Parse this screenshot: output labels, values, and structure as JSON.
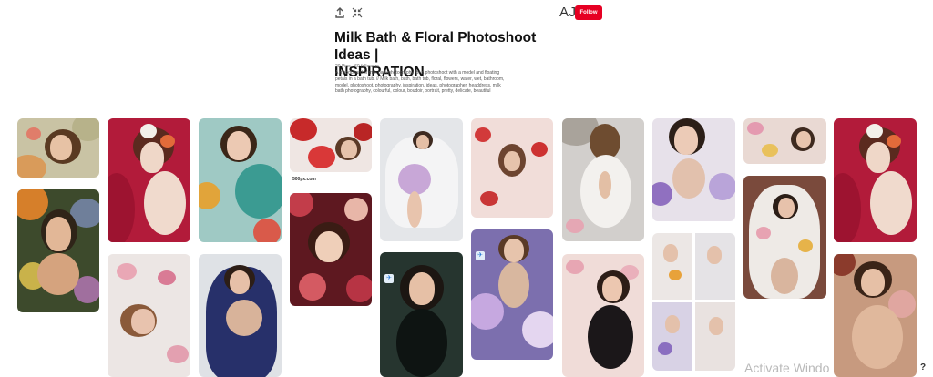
{
  "header": {
    "share_icon": "upload-share-icon",
    "expand_icon": "compress-arrows-icon",
    "initials": "AJ",
    "follow_label": "Follow",
    "accent": "#e60023"
  },
  "board": {
    "title_line1": "Milk Bath & Floral Photoshoot Ideas |",
    "title_line2": "INSPIRATION",
    "stats": "20 Pins · 60 followers",
    "description_lines": [
      "A moodboard of milk bath photography for a photoshoot with a model and floating",
      "petals in a bath tub. // Milk bath, bath, bath tub, floral, flowers, water, wet, bathroom,",
      "model, photoshoot, photography, inspiration, ideas, photographer, headdress, milk",
      "bath photography, colourful, colour, boudoir, portrait, pretty, delicate, beautiful"
    ]
  },
  "pins": {
    "caption_500px": "500px.com"
  },
  "overlay": {
    "watermark": "Activate Windo",
    "help_mark": "?"
  }
}
